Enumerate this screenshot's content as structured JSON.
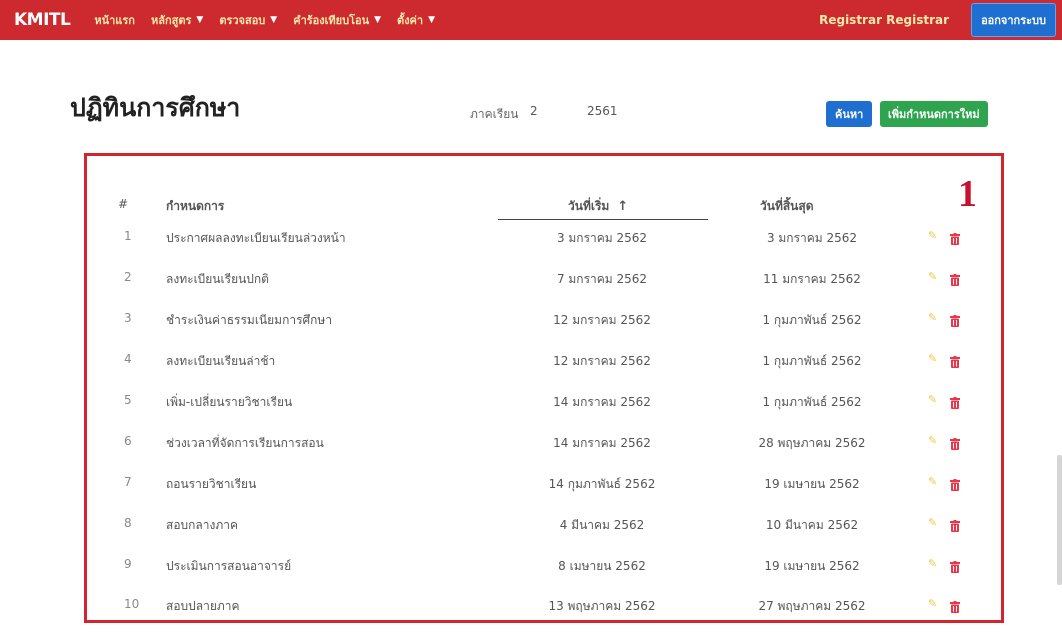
{
  "navbar": {
    "brand": "KMITL",
    "items": [
      {
        "label": "หน้าแรก",
        "dropdown": false
      },
      {
        "label": "หลักสูตร",
        "dropdown": true
      },
      {
        "label": "ตรวจสอบ",
        "dropdown": true
      },
      {
        "label": "คำร้องเทียบโอน",
        "dropdown": true
      },
      {
        "label": "ตั้งค่า",
        "dropdown": true
      }
    ],
    "user": "Registrar Registrar",
    "logout_label": "ออกจากระบบ"
  },
  "header": {
    "title": "ปฏิทินการศึกษา",
    "term_label": "ภาคเรียน",
    "term_value": "2",
    "year_value": "2561",
    "search_label": "ค้นหา",
    "add_label": "เพิ่มกำหนดการใหม่"
  },
  "marker": "1",
  "table": {
    "columns": {
      "num": "#",
      "name": "กำหนดการ",
      "start": "วันที่เริ่ม",
      "end": "วันที่สิ้นสุด"
    },
    "sort_indicator": "↑",
    "rows": [
      {
        "num": "1",
        "name": "ประกาศผลลงทะเบียนเรียนล่วงหน้า",
        "start": "3 มกราคม 2562",
        "end": "3 มกราคม 2562"
      },
      {
        "num": "2",
        "name": "ลงทะเบียนเรียนปกติ",
        "start": "7 มกราคม 2562",
        "end": "11 มกราคม 2562"
      },
      {
        "num": "3",
        "name": "ชำระเงินค่าธรรมเนียมการศึกษา",
        "start": "12 มกราคม 2562",
        "end": "1 กุมภาพันธ์ 2562"
      },
      {
        "num": "4",
        "name": "ลงทะเบียนเรียนล่าช้า",
        "start": "12 มกราคม 2562",
        "end": "1 กุมภาพันธ์ 2562"
      },
      {
        "num": "5",
        "name": "เพิ่ม-เปลี่ยนรายวิชาเรียน",
        "start": "14 มกราคม 2562",
        "end": "1 กุมภาพันธ์ 2562"
      },
      {
        "num": "6",
        "name": "ช่วงเวลาที่จัดการเรียนการสอน",
        "start": "14 มกราคม 2562",
        "end": "28 พฤษภาคม 2562"
      },
      {
        "num": "7",
        "name": "ถอนรายวิชาเรียน",
        "start": "14 กุมภาพันธ์ 2562",
        "end": "19 เมษายน 2562"
      },
      {
        "num": "8",
        "name": "สอบกลางภาค",
        "start": "4 มีนาคม 2562",
        "end": "10 มีนาคม 2562"
      },
      {
        "num": "9",
        "name": "ประเมินการสอนอาจารย์",
        "start": "8 เมษายน 2562",
        "end": "19 เมษายน 2562"
      },
      {
        "num": "10",
        "name": "สอบปลายภาค",
        "start": "13 พฤษภาคม 2562",
        "end": "27 พฤษภาคม 2562"
      }
    ]
  },
  "colors": {
    "navbar": "#cc2a2f",
    "primary": "#1e6fd0",
    "success": "#2ea44f",
    "edit": "#f2c744",
    "delete": "#e8364a",
    "frame": "#d1242d"
  },
  "icons": {
    "edit": "pencil-icon",
    "delete": "trash-icon",
    "dropdown": "chevron-down-icon"
  }
}
